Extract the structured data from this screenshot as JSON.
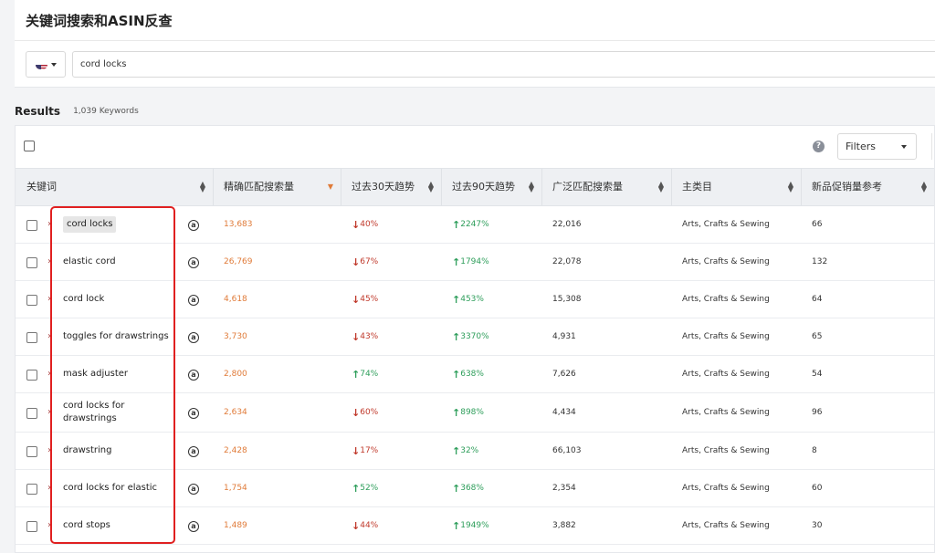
{
  "header": {
    "title": "关键词搜索和ASIN反查"
  },
  "search": {
    "country_flag": "us-flag-icon",
    "query": "cord locks"
  },
  "results": {
    "label": "Results",
    "count": "1,039 Keywords"
  },
  "toolbar": {
    "filters_label": "Filters"
  },
  "columns": [
    {
      "label": "关键词",
      "sort": "both"
    },
    {
      "label": "精确匹配搜索量",
      "sort": "desc"
    },
    {
      "label": "过去30天趋势",
      "sort": "both"
    },
    {
      "label": "过去90天趋势",
      "sort": "both"
    },
    {
      "label": "广泛匹配搜索量",
      "sort": "both"
    },
    {
      "label": "主类目",
      "sort": "both"
    },
    {
      "label": "新品促销量参考",
      "sort": "both"
    }
  ],
  "rows": [
    {
      "keyword": "cord locks",
      "exact": "13,683",
      "t30": "40%",
      "t30_dir": "down",
      "t90": "2247%",
      "t90_dir": "up",
      "broad": "22,016",
      "category": "Arts, Crafts & Sewing",
      "promo": "66"
    },
    {
      "keyword": "elastic cord",
      "exact": "26,769",
      "t30": "67%",
      "t30_dir": "down",
      "t90": "1794%",
      "t90_dir": "up",
      "broad": "22,078",
      "category": "Arts, Crafts & Sewing",
      "promo": "132"
    },
    {
      "keyword": "cord lock",
      "exact": "4,618",
      "t30": "45%",
      "t30_dir": "down",
      "t90": "453%",
      "t90_dir": "up",
      "broad": "15,308",
      "category": "Arts, Crafts & Sewing",
      "promo": "64"
    },
    {
      "keyword": "toggles for drawstrings",
      "exact": "3,730",
      "t30": "43%",
      "t30_dir": "down",
      "t90": "3370%",
      "t90_dir": "up",
      "broad": "4,931",
      "category": "Arts, Crafts & Sewing",
      "promo": "65"
    },
    {
      "keyword": "mask adjuster",
      "exact": "2,800",
      "t30": "74%",
      "t30_dir": "up",
      "t90": "638%",
      "t90_dir": "up",
      "broad": "7,626",
      "category": "Arts, Crafts & Sewing",
      "promo": "54"
    },
    {
      "keyword": "cord locks for drawstrings",
      "exact": "2,634",
      "t30": "60%",
      "t30_dir": "down",
      "t90": "898%",
      "t90_dir": "up",
      "broad": "4,434",
      "category": "Arts, Crafts & Sewing",
      "promo": "96"
    },
    {
      "keyword": "drawstring",
      "exact": "2,428",
      "t30": "17%",
      "t30_dir": "down",
      "t90": "32%",
      "t90_dir": "up",
      "broad": "66,103",
      "category": "Arts, Crafts & Sewing",
      "promo": "8"
    },
    {
      "keyword": "cord locks for elastic",
      "exact": "1,754",
      "t30": "52%",
      "t30_dir": "up",
      "t90": "368%",
      "t90_dir": "up",
      "broad": "2,354",
      "category": "Arts, Crafts & Sewing",
      "promo": "60"
    },
    {
      "keyword": "cord stops",
      "exact": "1,489",
      "t30": "44%",
      "t30_dir": "down",
      "t90": "1949%",
      "t90_dir": "up",
      "broad": "3,882",
      "category": "Arts, Crafts & Sewing",
      "promo": "30"
    }
  ],
  "colors": {
    "accent_orange": "#e07b39",
    "trend_down": "#c0392b",
    "trend_up": "#2e9e5b",
    "highlight_box": "#e02020"
  }
}
